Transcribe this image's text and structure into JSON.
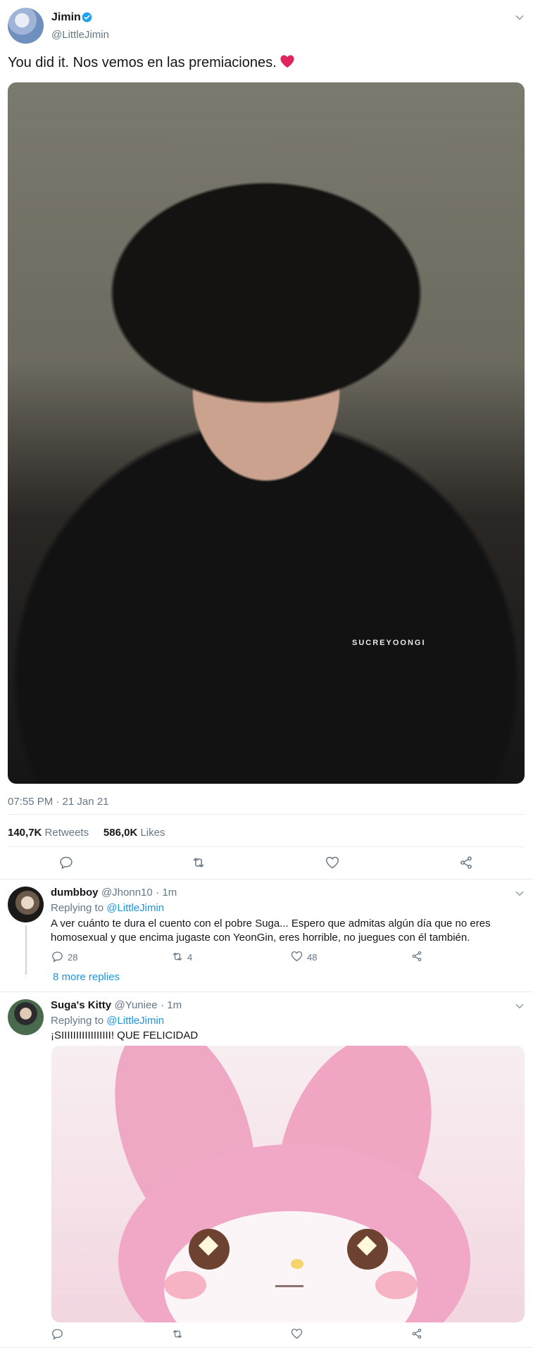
{
  "tweet": {
    "author_name": "Jimin",
    "author_handle": "@LittleJimin",
    "verified": true,
    "text": "You did it. Nos vemos en las premiaciones.",
    "emoji": "heart",
    "photo_watermark": "SUCREYOONGI",
    "timestamp": "07:55 PM · 21 Jan 21",
    "retweets_count": "140,7K",
    "retweets_label": "Retweets",
    "likes_count": "586,0K",
    "likes_label": "Likes"
  },
  "actions": {
    "icons": [
      "reply-icon",
      "retweet-icon",
      "like-icon",
      "share-icon"
    ]
  },
  "replies": [
    {
      "name": "dumbboy",
      "handle": "@Jhonn10",
      "time": "· 1m",
      "replying_prefix": "Replying to",
      "replying_to": "@LittleJimin",
      "text_line1": "A ver cuánto te dura el cuento con el pobre Suga... Espero que admitas algún día que no eres",
      "text_line2": "homosexual y que encima jugaste con YeonGin, eres horrible,  no juegues con él también.",
      "reply_count": "28",
      "retweet_count": "4",
      "like_count": "48",
      "more_replies": "8 more replies"
    },
    {
      "name": "Suga's Kitty",
      "handle": "@Yuniee",
      "time": "· 1m",
      "replying_prefix": "Replying to",
      "replying_to": "@LittleJimin",
      "text": "¡SIIIIIIIIIIIIIIIII! QUE FELICIDAD"
    }
  ],
  "colors": {
    "link": "#1b95e0",
    "muted": "#657786",
    "verified": "#1da1f2",
    "heart": "#e0245e"
  }
}
